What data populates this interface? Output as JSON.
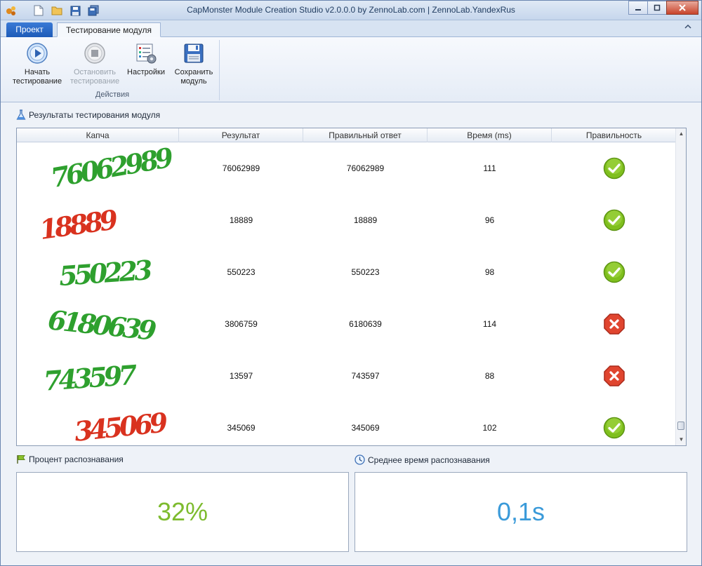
{
  "window": {
    "title": "CapMonster Module Creation Studio v2.0.0.0 by ZennoLab.com | ZennoLab.YandexRus"
  },
  "tabs": {
    "app_tab": "Проект",
    "active_tab": "Тестирование модуля"
  },
  "ribbon": {
    "group_label": "Действия",
    "buttons": [
      {
        "line1": "Начать",
        "line2": "тестирование",
        "icon": "play-icon",
        "enabled": true
      },
      {
        "line1": "Остановить",
        "line2": "тестирование",
        "icon": "stop-icon",
        "enabled": false
      },
      {
        "line1": "Настройки",
        "line2": "",
        "icon": "settings-icon",
        "enabled": true
      },
      {
        "line1": "Сохранить",
        "line2": "модуль",
        "icon": "floppy-icon",
        "enabled": true
      }
    ]
  },
  "results": {
    "title": "Результаты тестирования модуля",
    "columns": [
      "Капча",
      "Результат",
      "Правильный ответ",
      "Время (ms)",
      "Правильность"
    ],
    "rows": [
      {
        "captcha_text": "76062989",
        "captcha_color": "#2ea02e",
        "result": "76062989",
        "answer": "76062989",
        "time": "111",
        "correct": true
      },
      {
        "captcha_text": "18889",
        "captcha_color": "#d9321f",
        "result": "18889",
        "answer": "18889",
        "time": "96",
        "correct": true
      },
      {
        "captcha_text": "550223",
        "captcha_color": "#2ea02e",
        "result": "550223",
        "answer": "550223",
        "time": "98",
        "correct": true
      },
      {
        "captcha_text": "6180639",
        "captcha_color": "#2ea02e",
        "result": "3806759",
        "answer": "6180639",
        "time": "114",
        "correct": false
      },
      {
        "captcha_text": "743597",
        "captcha_color": "#2ea02e",
        "result": "13597",
        "answer": "743597",
        "time": "88",
        "correct": false
      },
      {
        "captcha_text": "345069",
        "captcha_color": "#d9321f",
        "result": "345069",
        "answer": "345069",
        "time": "102",
        "correct": true
      }
    ]
  },
  "stats": {
    "recognition_label": "Процент распознавания",
    "recognition_value": "32%",
    "recognition_color": "#7dbb2e",
    "avg_time_label": "Среднее время распознавания",
    "avg_time_value": "0,1s",
    "avg_time_color": "#3a9ad9"
  }
}
